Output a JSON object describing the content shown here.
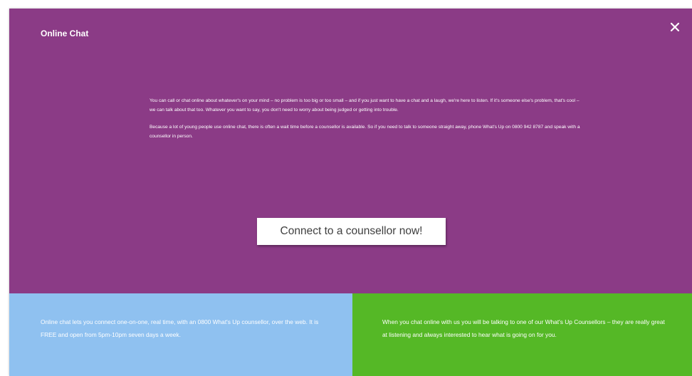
{
  "modal": {
    "title": "Online Chat",
    "close_label": "×",
    "intro_paragraphs": [
      "You can call or chat online about whatever's on your mind – no problem is too big or too small – and if you just want to have a chat and a laugh, we're here to listen. If it's someone else's problem, that's cool – we can talk about that too. Whatever you want to say, you don't need to worry about being judged or getting into trouble.",
      "Because a lot of young people use online chat, there is often a wait time before a counsellor is available. So if you need to talk to someone straight away, phone What's Up on 0800 942 8787 and speak with a counsellor in person."
    ],
    "connect_button_label": "Connect to a counsellor now!"
  },
  "panels": {
    "left_text": "Online chat lets you connect one-on-one, real time, with an 0800 What's Up counsellor, over the web. It is FREE and open from 5pm-10pm seven days a week.",
    "right_text": "When you chat online with us you will be talking to one of our What's Up Counsellors – they are really great at listening and always interested to hear what is going on for you."
  },
  "colors": {
    "modal_bg": "#8b3b86",
    "left_panel_bg": "#8fc1f0",
    "right_panel_bg": "#55b826",
    "text": "#ffffff"
  }
}
